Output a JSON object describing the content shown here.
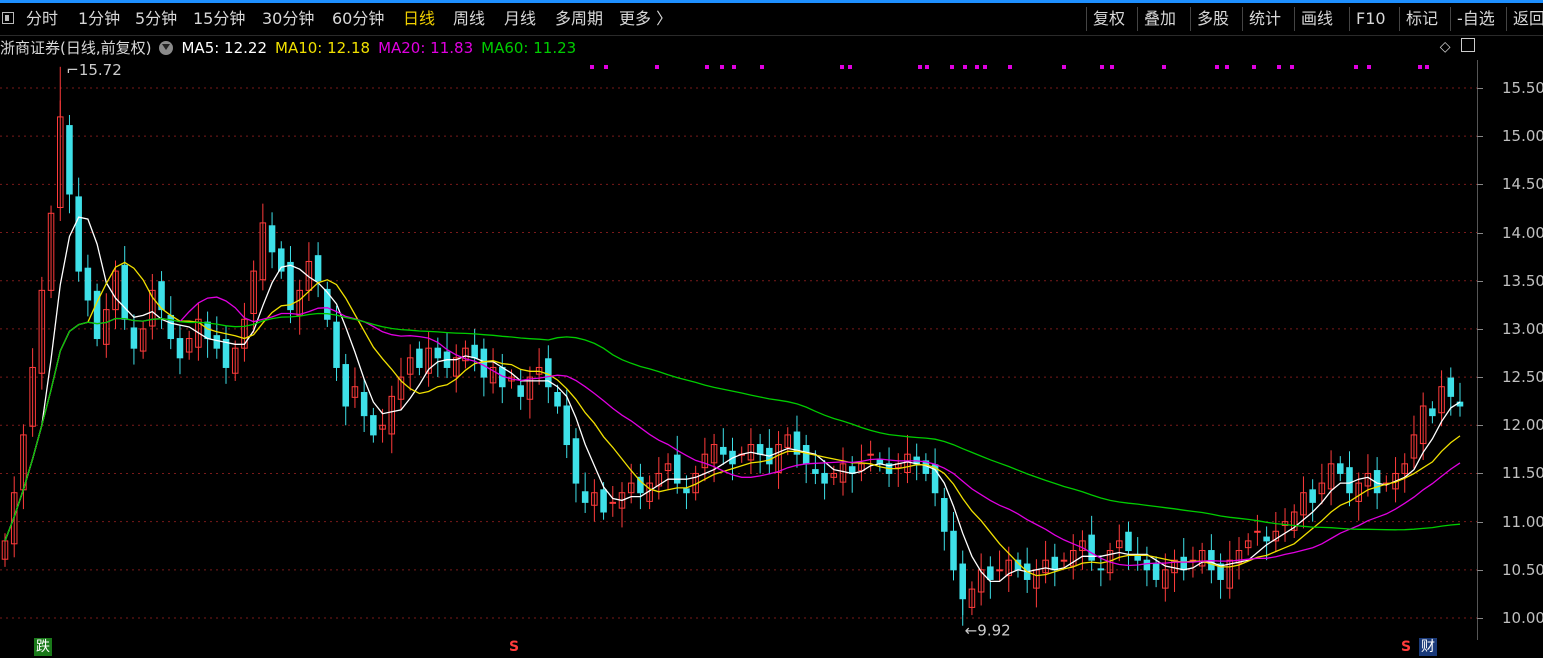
{
  "toolbar": {
    "periods": [
      {
        "label": "分时",
        "active": false
      },
      {
        "label": "1分钟",
        "active": false
      },
      {
        "label": "5分钟",
        "active": false
      },
      {
        "label": "15分钟",
        "active": false
      },
      {
        "label": "30分钟",
        "active": false
      },
      {
        "label": "60分钟",
        "active": false
      },
      {
        "label": "日线",
        "active": true
      },
      {
        "label": "周线",
        "active": false
      },
      {
        "label": "月线",
        "active": false
      },
      {
        "label": "多周期",
        "active": false
      },
      {
        "label": "更多 〉",
        "active": false
      }
    ],
    "tools": [
      "复权",
      "叠加",
      "多股",
      "统计",
      "画线",
      "F10",
      "标记",
      "-自选",
      "返回"
    ]
  },
  "info": {
    "title": "浙商证券(日线,前复权)",
    "ma5": "MA5: 12.22",
    "ma10": "MA10: 12.18",
    "ma20": "MA20: 11.83",
    "ma60": "MA60: 11.23"
  },
  "colors": {
    "up": "#ff3b3b",
    "down": "#3ee0e8",
    "ma5": "#ffffff",
    "ma10": "#f0e000",
    "ma20": "#e000e0",
    "ma60": "#00cc00",
    "grid": "#7a1a1a"
  },
  "annotations": {
    "high": "15.72",
    "low": "9.92"
  },
  "badges": {
    "left": "跌",
    "s_mark": "S",
    "cai": "财"
  },
  "chart_data": {
    "type": "candlestick",
    "ylim": [
      9.9,
      15.7
    ],
    "yticks": [
      "15.50",
      "15.00",
      "14.50",
      "14.00",
      "13.50",
      "13.00",
      "12.50",
      "12.00",
      "11.50",
      "11.00",
      "10.50",
      "10.00"
    ],
    "ma5_last": 12.22,
    "ma10_last": 12.18,
    "ma20_last": 11.83,
    "ma60_last": 11.23,
    "high": 15.72,
    "low": 9.92,
    "close": [
      10.8,
      11.3,
      11.9,
      12.6,
      13.4,
      14.2,
      15.2,
      14.4,
      13.6,
      13.3,
      12.9,
      13.2,
      13.6,
      13.1,
      12.8,
      13.0,
      13.4,
      13.2,
      12.9,
      12.7,
      12.9,
      13.1,
      12.9,
      12.8,
      12.6,
      12.8,
      13.1,
      13.6,
      14.1,
      13.8,
      13.6,
      13.2,
      13.4,
      13.7,
      13.5,
      13.1,
      12.6,
      12.2,
      12.4,
      12.1,
      11.9,
      12.0,
      12.3,
      12.5,
      12.7,
      12.6,
      12.8,
      12.7,
      12.6,
      12.7,
      12.8,
      12.7,
      12.5,
      12.6,
      12.4,
      12.5,
      12.3,
      12.5,
      12.6,
      12.4,
      12.2,
      11.8,
      11.4,
      11.2,
      11.3,
      11.1,
      11.2,
      11.3,
      11.4,
      11.3,
      11.4,
      11.5,
      11.6,
      11.4,
      11.3,
      11.5,
      11.7,
      11.8,
      11.7,
      11.6,
      11.7,
      11.8,
      11.7,
      11.6,
      11.8,
      11.9,
      11.7,
      11.6,
      11.5,
      11.4,
      11.5,
      11.6,
      11.5,
      11.6,
      11.7,
      11.6,
      11.5,
      11.6,
      11.7,
      11.6,
      11.5,
      11.3,
      10.9,
      10.5,
      10.2,
      10.3,
      10.5,
      10.4,
      10.5,
      10.6,
      10.5,
      10.4,
      10.5,
      10.6,
      10.5,
      10.6,
      10.7,
      10.8,
      10.6,
      10.5,
      10.7,
      10.8,
      10.7,
      10.6,
      10.5,
      10.4,
      10.5,
      10.6,
      10.5,
      10.6,
      10.7,
      10.5,
      10.4,
      10.6,
      10.7,
      10.8,
      10.9,
      10.8,
      10.9,
      11.0,
      11.1,
      11.3,
      11.2,
      11.4,
      11.6,
      11.5,
      11.3,
      11.4,
      11.5,
      11.3,
      11.4,
      11.5,
      11.6,
      11.9,
      12.2,
      12.1,
      12.4,
      12.3,
      12.2
    ]
  }
}
